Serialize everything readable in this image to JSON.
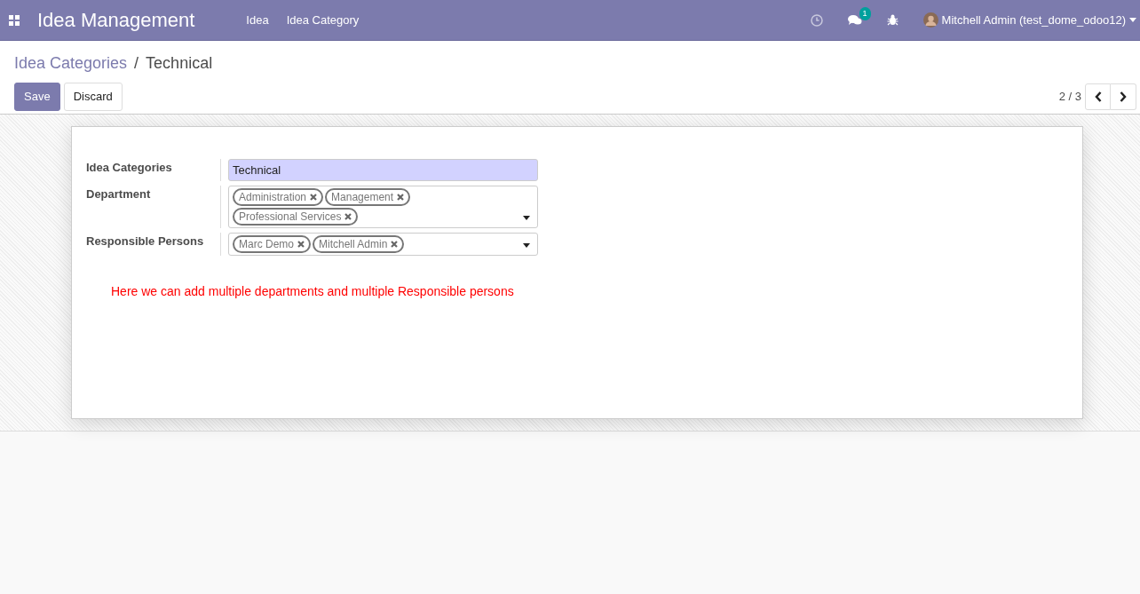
{
  "navbar": {
    "app_title": "Idea Management",
    "menu": [
      {
        "label": "Idea"
      },
      {
        "label": "Idea Category"
      }
    ],
    "messages_count": "1",
    "user": "Mitchell Admin (test_dome_odoo12)"
  },
  "breadcrumb": [
    {
      "label": "Idea Categories"
    },
    {
      "label": "Technical"
    }
  ],
  "breadcrumb_separator": "/",
  "buttons": [
    {
      "label": "Save",
      "kind": "primary"
    },
    {
      "label": "Discard",
      "kind": "secondary"
    }
  ],
  "pager": "2 / 3",
  "form": {
    "fields": [
      {
        "label": "Idea Categories",
        "kind": "text",
        "value": "Technical"
      },
      {
        "label": "Department",
        "kind": "tags",
        "tags": [
          "Administration",
          "Management",
          "Professional Services"
        ]
      },
      {
        "label": "Responsible Persons",
        "kind": "tags",
        "tags": [
          "Marc Demo",
          "Mitchell Admin"
        ]
      }
    ],
    "note": "Here we can add multiple departments and multiple Responsible persons"
  }
}
